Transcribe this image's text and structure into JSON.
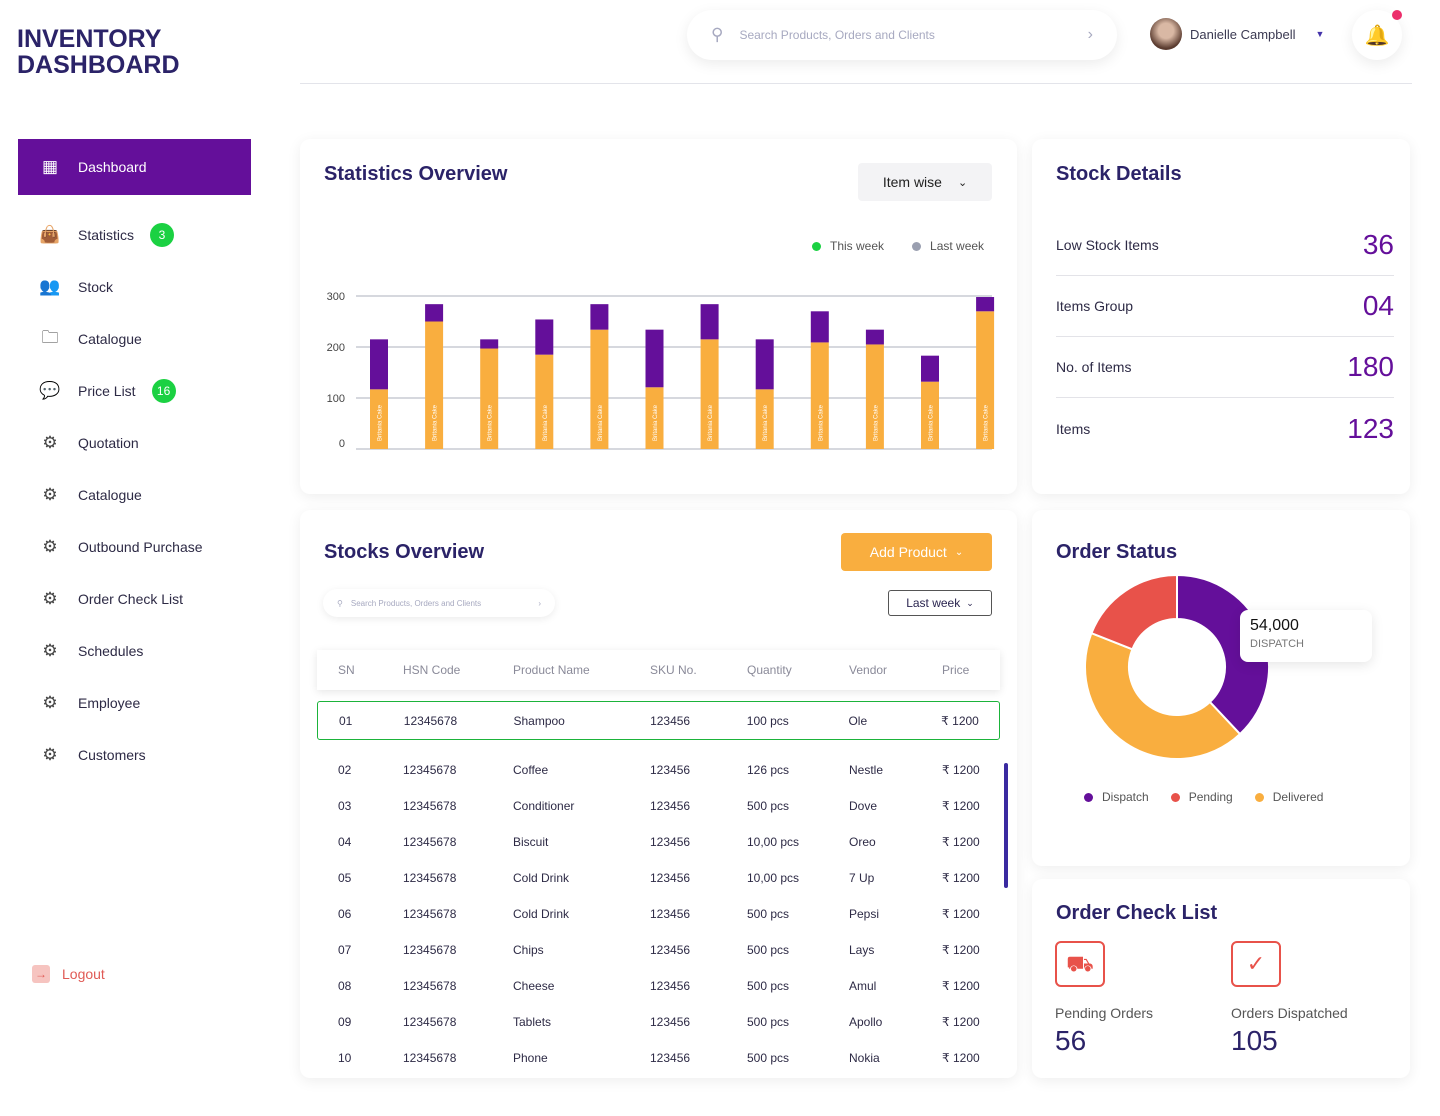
{
  "app": {
    "title_line1": "INVENTORY",
    "title_line2": "DASHBOARD"
  },
  "header": {
    "search_placeholder": "Search Products, Orders and Clients",
    "user_name": "Danielle Campbell",
    "has_notification": true
  },
  "sidebar": {
    "items": [
      {
        "label": "Dashboard",
        "icon": "grid-icon",
        "active": true
      },
      {
        "label": "Statistics",
        "icon": "bag-icon",
        "badge": "3"
      },
      {
        "label": "Stock",
        "icon": "users-icon"
      },
      {
        "label": "Catalogue",
        "icon": "folder-icon"
      },
      {
        "label": "Price List",
        "icon": "chat-icon",
        "badge": "16"
      },
      {
        "label": "Quotation",
        "icon": "gear-icon"
      },
      {
        "label": "Catalogue",
        "icon": "gear-icon"
      },
      {
        "label": "Outbound Purchase",
        "icon": "gear-icon"
      },
      {
        "label": "Order Check List",
        "icon": "gear-icon"
      },
      {
        "label": "Schedules",
        "icon": "gear-icon"
      },
      {
        "label": "Employee",
        "icon": "gear-icon"
      },
      {
        "label": "Customers",
        "icon": "gear-icon"
      }
    ],
    "logout": "Logout"
  },
  "statistics": {
    "title": "Statistics Overview",
    "dropdown": "Item wise",
    "legend": [
      {
        "label": "This week",
        "color": "#1bd142"
      },
      {
        "label": "Last week",
        "color": "#9a9fb0"
      }
    ]
  },
  "chart_data": {
    "type": "bar",
    "stacked": true,
    "yticks": [
      "0",
      "100",
      "200",
      "300"
    ],
    "ylim": [
      0,
      300
    ],
    "grid": true,
    "bar_label": "Britania Cake",
    "series": [
      {
        "color": "#f9ae3f",
        "values": [
          117,
          250,
          197,
          185,
          234,
          121,
          215,
          117,
          209,
          205,
          132,
          270
        ]
      },
      {
        "color": "#640f9a",
        "values": [
          98,
          34,
          18,
          69,
          50,
          113,
          69,
          98,
          61,
          29,
          51,
          28
        ]
      }
    ]
  },
  "stock_details": {
    "title": "Stock Details",
    "rows": [
      {
        "label": "Low Stock Items",
        "value": "36"
      },
      {
        "label": "Items Group",
        "value": "04"
      },
      {
        "label": "No. of Items",
        "value": "180"
      },
      {
        "label": "Items",
        "value": "123"
      }
    ]
  },
  "stocks": {
    "title": "Stocks Overview",
    "add_button": "Add Product",
    "search_placeholder": "Search Products, Orders and Clients",
    "period": "Last week",
    "columns": [
      "SN",
      "HSN Code",
      "Product Name",
      "SKU No.",
      "Quantity",
      "Vendor",
      "Price"
    ],
    "rows": [
      [
        "01",
        "12345678",
        "Shampoo",
        "123456",
        "100 pcs",
        "Ole",
        "₹ 1200"
      ],
      [
        "02",
        "12345678",
        "Coffee",
        "123456",
        "126 pcs",
        "Nestle",
        "₹ 1200"
      ],
      [
        "03",
        "12345678",
        "Conditioner",
        "123456",
        "500 pcs",
        "Dove",
        "₹ 1200"
      ],
      [
        "04",
        "12345678",
        "Biscuit",
        "123456",
        "10,00 pcs",
        "Oreo",
        "₹ 1200"
      ],
      [
        "05",
        "12345678",
        "Cold Drink",
        "123456",
        "10,00 pcs",
        "7 Up",
        "₹ 1200"
      ],
      [
        "06",
        "12345678",
        "Cold Drink",
        "123456",
        "500 pcs",
        "Pepsi",
        "₹ 1200"
      ],
      [
        "07",
        "12345678",
        "Chips",
        "123456",
        "500 pcs",
        "Lays",
        "₹ 1200"
      ],
      [
        "08",
        "12345678",
        "Cheese",
        "123456",
        "500 pcs",
        "Amul",
        "₹ 1200"
      ],
      [
        "09",
        "12345678",
        "Tablets",
        "123456",
        "500 pcs",
        "Apollo",
        "₹ 1200"
      ],
      [
        "10",
        "12345678",
        "Phone",
        "123456",
        "500 pcs",
        "Nokia",
        "₹ 1200"
      ]
    ]
  },
  "order_status": {
    "title": "Order Status",
    "tooltip_value": "54,000",
    "tooltip_label": "DISPATCH",
    "slices": [
      {
        "label": "Dispatch",
        "percent": 38,
        "color": "#640f9a"
      },
      {
        "label": "Delivered",
        "percent": 43,
        "color": "#f9ae3f"
      },
      {
        "label": "Pending",
        "percent": 19,
        "color": "#e8524a"
      }
    ],
    "legend": [
      {
        "label": "Dispatch",
        "color": "#640f9a"
      },
      {
        "label": "Pending",
        "color": "#e8524a"
      },
      {
        "label": "Delivered",
        "color": "#f9ae3f"
      }
    ]
  },
  "order_check": {
    "title": "Order Check List",
    "items": [
      {
        "label": "Pending Orders",
        "value": "56",
        "icon": "truck-icon"
      },
      {
        "label": "Orders Dispatched",
        "value": "105",
        "icon": "truck-check-icon"
      }
    ]
  }
}
